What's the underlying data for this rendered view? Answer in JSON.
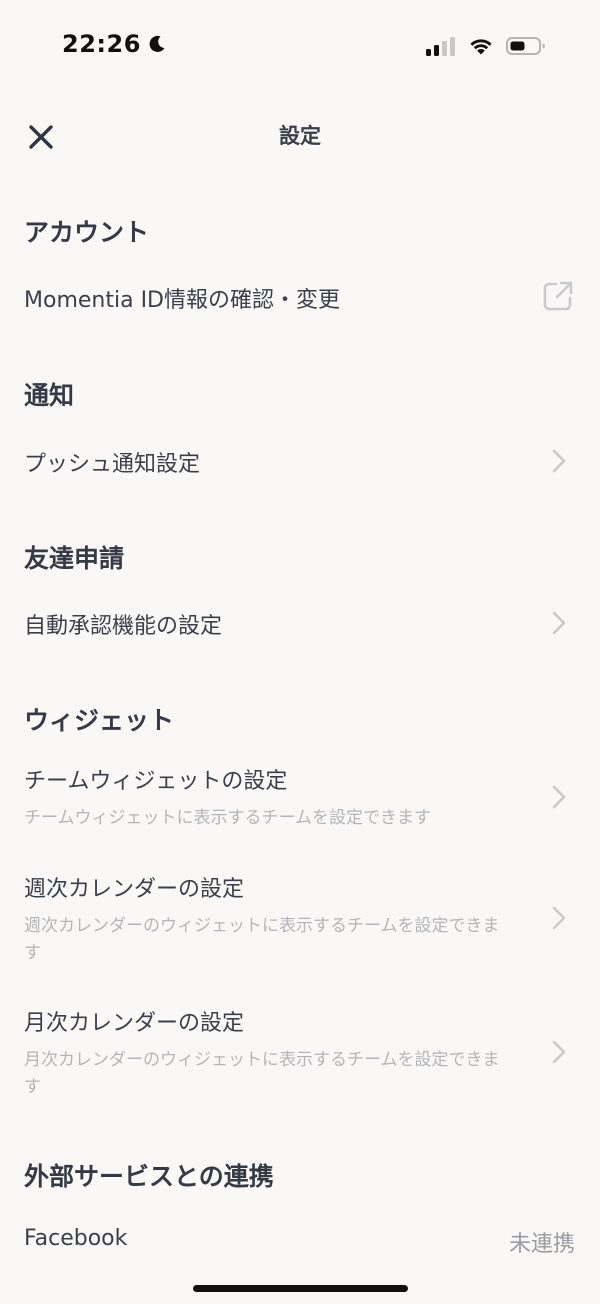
{
  "status_bar": {
    "time": "22:26",
    "icons": [
      "moon-icon",
      "cellular-signal-icon",
      "wifi-icon",
      "battery-icon"
    ]
  },
  "header": {
    "title": "設定",
    "close_icon": "close-icon"
  },
  "sections": {
    "account": {
      "title": "アカウント",
      "items": [
        {
          "label": "Momentia ID情報の確認・変更",
          "icon": "external-link-icon"
        }
      ]
    },
    "notification": {
      "title": "通知",
      "items": [
        {
          "label": "プッシュ通知設定",
          "icon": "chevron-right-icon"
        }
      ]
    },
    "friend_request": {
      "title": "友達申請",
      "items": [
        {
          "label": "自動承認機能の設定",
          "icon": "chevron-right-icon"
        }
      ]
    },
    "widget": {
      "title": "ウィジェット",
      "items": [
        {
          "label": "チームウィジェットの設定",
          "description": "チームウィジェットに表示するチームを設定できます",
          "icon": "chevron-right-icon"
        },
        {
          "label": "週次カレンダーの設定",
          "description": "週次カレンダーのウィジェットに表示するチームを設定できます",
          "icon": "chevron-right-icon"
        },
        {
          "label": "月次カレンダーの設定",
          "description": "月次カレンダーのウィジェットに表示するチームを設定できます",
          "icon": "chevron-right-icon"
        }
      ]
    },
    "external": {
      "title": "外部サービスとの連携",
      "items": [
        {
          "label": "Facebook",
          "value": "未連携"
        }
      ]
    }
  },
  "colors": {
    "background": "#f9f8f6",
    "text_primary": "#3a3f4b",
    "text_secondary": "#b3b5ba",
    "icon_muted": "#c9cacd"
  }
}
